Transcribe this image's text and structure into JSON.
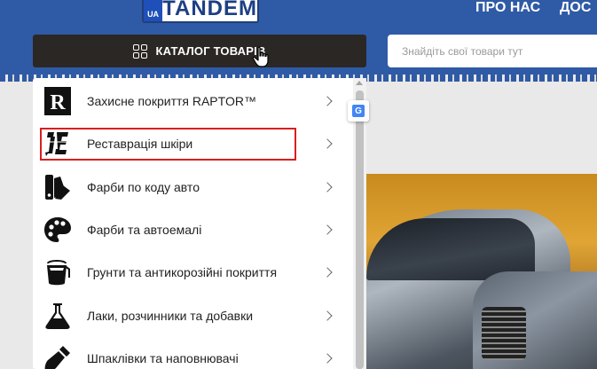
{
  "header": {
    "logo_text": "TANDEM",
    "logo_badge": "UA",
    "nav": [
      "ПРО НАС",
      "ДОС"
    ]
  },
  "catalog_button": {
    "label": "КАТАЛОГ ТОВАРІВ",
    "icon": "grid-icon"
  },
  "search": {
    "placeholder": "Знайдіть свої товари тут",
    "value": ""
  },
  "menu": {
    "items": [
      {
        "label": "Захисне покриття RAPTOR™",
        "icon": "raptor-logo-icon"
      },
      {
        "label": "Реставрація шкіри",
        "icon": "leather-restoration-logo-icon",
        "highlighted": true
      },
      {
        "label": "Фарби по коду авто",
        "icon": "color-swatches-icon"
      },
      {
        "label": "Фарби та автоемалі",
        "icon": "paint-palette-icon"
      },
      {
        "label": "Грунти та антикорозійні покриття",
        "icon": "paint-bucket-icon"
      },
      {
        "label": "Лаки, розчинники та добавки",
        "icon": "flask-icon"
      },
      {
        "label": "Шпаклівки та наповнювачі",
        "icon": "spatula-icon"
      }
    ]
  },
  "translate_badge": {
    "letter": "G"
  },
  "colors": {
    "header_blue": "#2f5aa6",
    "catalog_dark": "#2b2724",
    "highlight_red": "#d71f1f"
  }
}
